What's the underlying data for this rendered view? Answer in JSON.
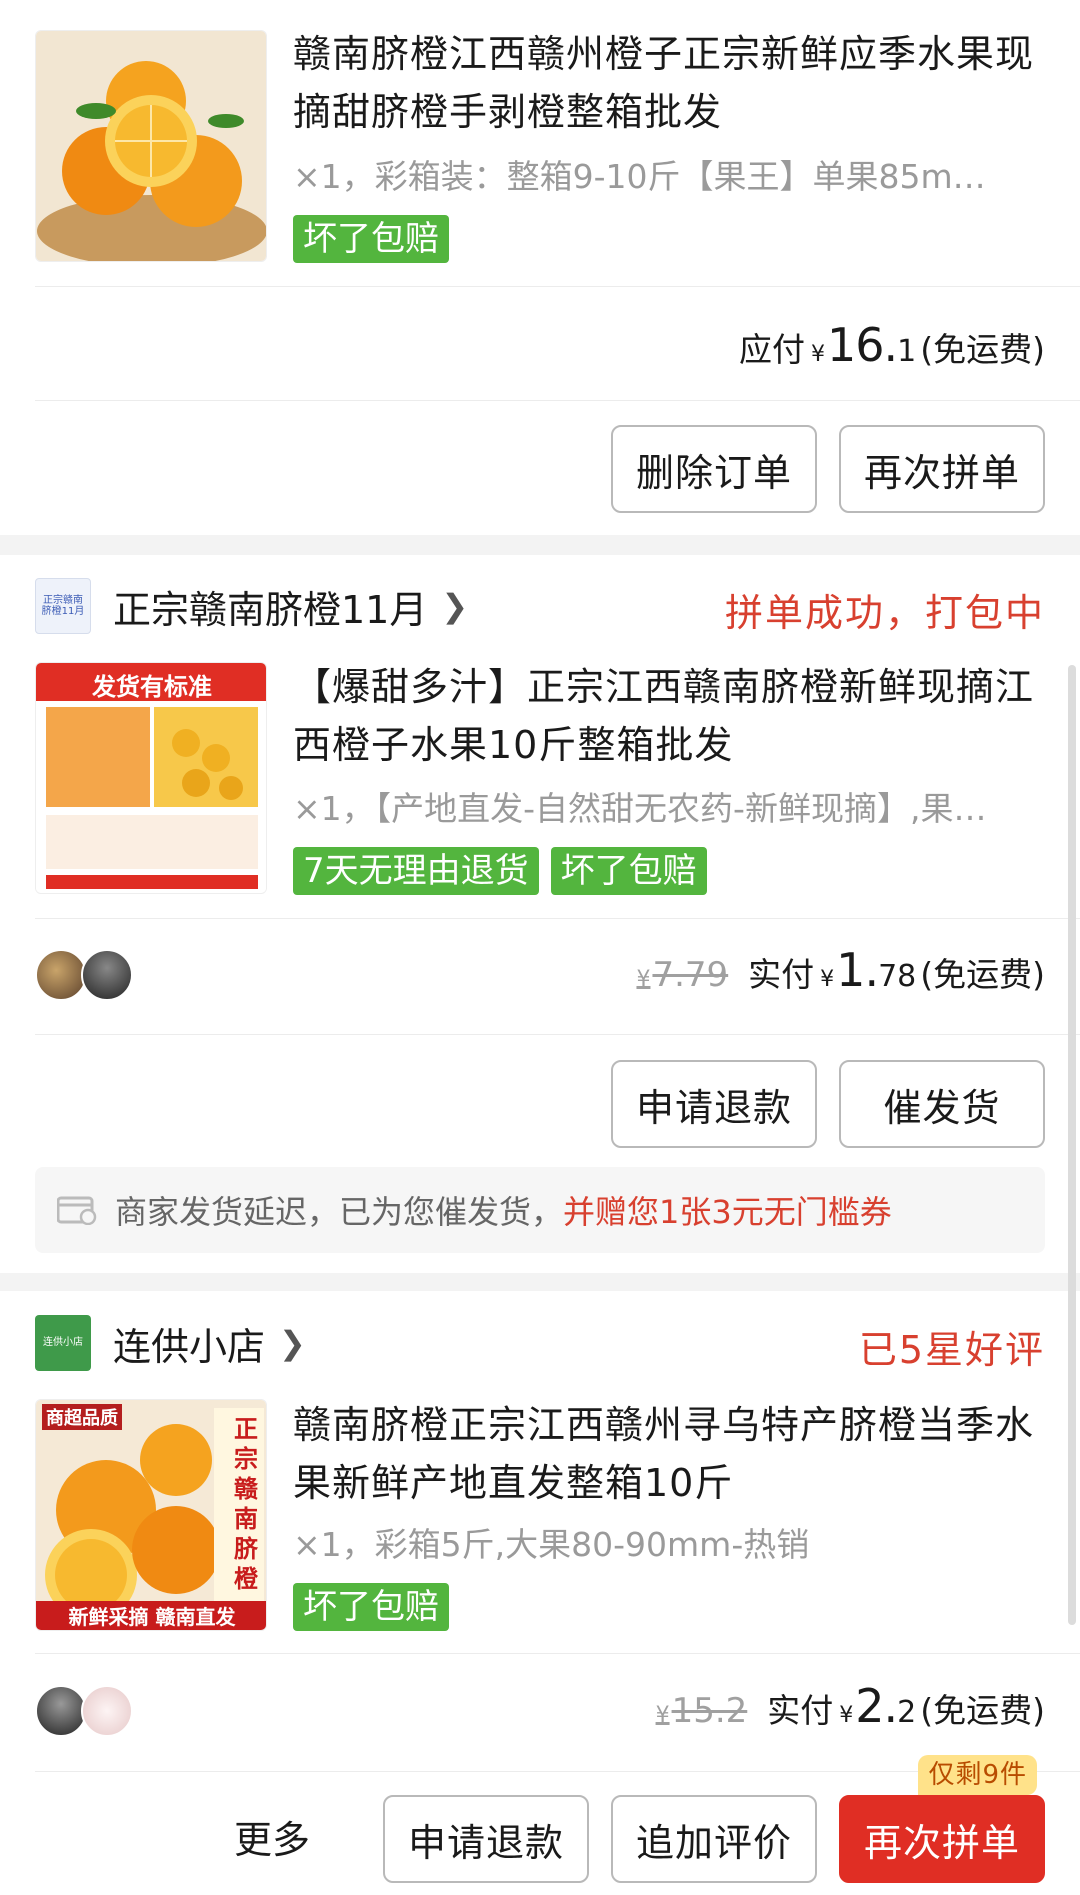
{
  "orders": [
    {
      "title": "赣南脐橙江西赣州橙子正宗新鲜应季水果现摘甜脐橙手剥橙整箱批发",
      "spec": "×1，彩箱装：整箱9-10斤【果王】单果85m…",
      "tags": [
        "坏了包赔"
      ],
      "price_label": "应付",
      "currency": "¥",
      "price_int": "16.",
      "price_dec": "1",
      "shipping": "(免运费)",
      "buttons": [
        "删除订单",
        "再次拼单"
      ]
    },
    {
      "shop": "正宗赣南脐橙11月",
      "shop_logo_text": "正宗赣南脐橙11月",
      "status": "拼单成功，打包中",
      "title": "【爆甜多汁】正宗江西赣南脐橙新鲜现摘江西橙子水果10斤整箱批发",
      "spec": "×1，【产地直发-自然甜无农药-新鲜现摘】,果…",
      "tags": [
        "7天无理由退货",
        "坏了包赔"
      ],
      "orig_currency": "¥",
      "orig_price": "7.79",
      "price_label": "实付",
      "currency": "¥",
      "price_int": "1.",
      "price_dec": "78",
      "shipping": "(免运费)",
      "buttons": [
        "申请退款",
        "催发货"
      ],
      "notice_text": "商家发货延迟，已为您催发货，",
      "notice_highlight": "并赠您1张3元无门槛券",
      "thumb_caption": "发货有标准"
    },
    {
      "shop": "连供小店",
      "shop_logo_text": "连供小店",
      "status": "已5星好评",
      "title": "赣南脐橙正宗江西赣州寻乌特产脐橙当季水果新鲜产地直发整箱10斤",
      "spec": "×1，彩箱5斤,大果80-90mm-热销",
      "tags": [
        "坏了包赔"
      ],
      "orig_currency": "¥",
      "orig_price": "15.2",
      "price_label": "实付",
      "currency": "¥",
      "price_int": "2.",
      "price_dec": "2",
      "shipping": "(免运费)",
      "more_label": "更多",
      "buttons": [
        "申请退款",
        "追加评价",
        "再次拼单"
      ],
      "badge": "仅剩9件",
      "thumb_caption_top": "商超品质",
      "thumb_caption_bottom": "新鲜采摘 赣南直发",
      "thumb_side_text": "正宗赣南脐橙"
    }
  ],
  "colors": {
    "accent_red": "#e02e24",
    "status_red": "#d8402f",
    "tag_green": "#53b53e"
  }
}
